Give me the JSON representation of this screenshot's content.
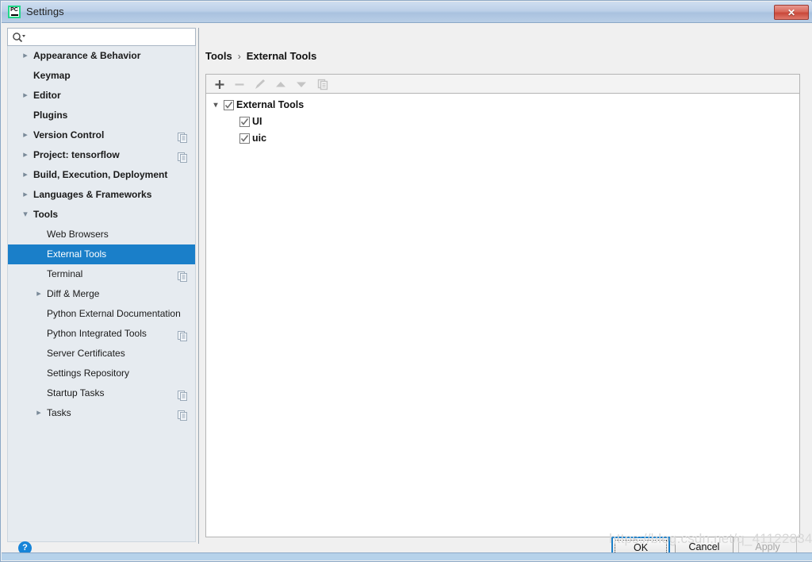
{
  "window": {
    "title": "Settings",
    "app_icon": "pycharm-icon",
    "close_label": "✕"
  },
  "search": {
    "value": "",
    "placeholder": "",
    "icon": "search-icon"
  },
  "sidebar": {
    "items": [
      {
        "label": "Appearance & Behavior",
        "level": 0,
        "arrow": "▸",
        "selected": false,
        "config_icon": false
      },
      {
        "label": "Keymap",
        "level": 0,
        "arrow": "",
        "selected": false,
        "config_icon": false
      },
      {
        "label": "Editor",
        "level": 0,
        "arrow": "▸",
        "selected": false,
        "config_icon": false
      },
      {
        "label": "Plugins",
        "level": 0,
        "arrow": "",
        "selected": false,
        "config_icon": false
      },
      {
        "label": "Version Control",
        "level": 0,
        "arrow": "▸",
        "selected": false,
        "config_icon": true
      },
      {
        "label": "Project: tensorflow",
        "level": 0,
        "arrow": "▸",
        "selected": false,
        "config_icon": true
      },
      {
        "label": "Build, Execution, Deployment",
        "level": 0,
        "arrow": "▸",
        "selected": false,
        "config_icon": false
      },
      {
        "label": "Languages & Frameworks",
        "level": 0,
        "arrow": "▸",
        "selected": false,
        "config_icon": false
      },
      {
        "label": "Tools",
        "level": 0,
        "arrow": "▾",
        "selected": false,
        "config_icon": false
      },
      {
        "label": "Web Browsers",
        "level": 1,
        "arrow": "",
        "selected": false,
        "config_icon": false
      },
      {
        "label": "External Tools",
        "level": 1,
        "arrow": "",
        "selected": true,
        "config_icon": false
      },
      {
        "label": "Terminal",
        "level": 1,
        "arrow": "",
        "selected": false,
        "config_icon": true
      },
      {
        "label": "Diff & Merge",
        "level": 1,
        "arrow": "▸",
        "selected": false,
        "config_icon": false
      },
      {
        "label": "Python External Documentation",
        "level": 1,
        "arrow": "",
        "selected": false,
        "config_icon": false
      },
      {
        "label": "Python Integrated Tools",
        "level": 1,
        "arrow": "",
        "selected": false,
        "config_icon": true
      },
      {
        "label": "Server Certificates",
        "level": 1,
        "arrow": "",
        "selected": false,
        "config_icon": false
      },
      {
        "label": "Settings Repository",
        "level": 1,
        "arrow": "",
        "selected": false,
        "config_icon": false
      },
      {
        "label": "Startup Tasks",
        "level": 1,
        "arrow": "",
        "selected": false,
        "config_icon": true
      },
      {
        "label": "Tasks",
        "level": 1,
        "arrow": "▸",
        "selected": false,
        "config_icon": true
      }
    ]
  },
  "breadcrumb": {
    "parent": "Tools",
    "separator": "›",
    "current": "External Tools"
  },
  "toolbar": {
    "buttons": [
      {
        "name": "add-button",
        "icon": "plus-icon",
        "enabled": true
      },
      {
        "name": "remove-button",
        "icon": "minus-icon",
        "enabled": false
      },
      {
        "name": "edit-button",
        "icon": "pencil-icon",
        "enabled": false
      },
      {
        "name": "move-up-button",
        "icon": "arrow-up-icon",
        "enabled": false
      },
      {
        "name": "move-down-button",
        "icon": "arrow-down-icon",
        "enabled": false
      },
      {
        "name": "copy-button",
        "icon": "copy-icon",
        "enabled": false
      }
    ]
  },
  "tools_tree": {
    "root": {
      "label": "External Tools",
      "checked": true,
      "expanded": true,
      "arrow": "▾"
    },
    "children": [
      {
        "label": "UI",
        "checked": true
      },
      {
        "label": "uic",
        "checked": true
      }
    ]
  },
  "footer": {
    "help_icon": "?",
    "ok_label": "OK",
    "cancel_label": "Cancel",
    "apply_label": "Apply"
  },
  "watermark": {
    "text": "https://blog.csdn.net/q_41122834"
  },
  "colors": {
    "accent": "#1a7fc9",
    "titlebar": "#b9cee6",
    "sidebar_bg": "#e6ebf0",
    "panel_bg": "#ffffff",
    "footer_bg": "#f0f0f0",
    "close_red": "#c9483a",
    "help_blue": "#1684d8"
  }
}
